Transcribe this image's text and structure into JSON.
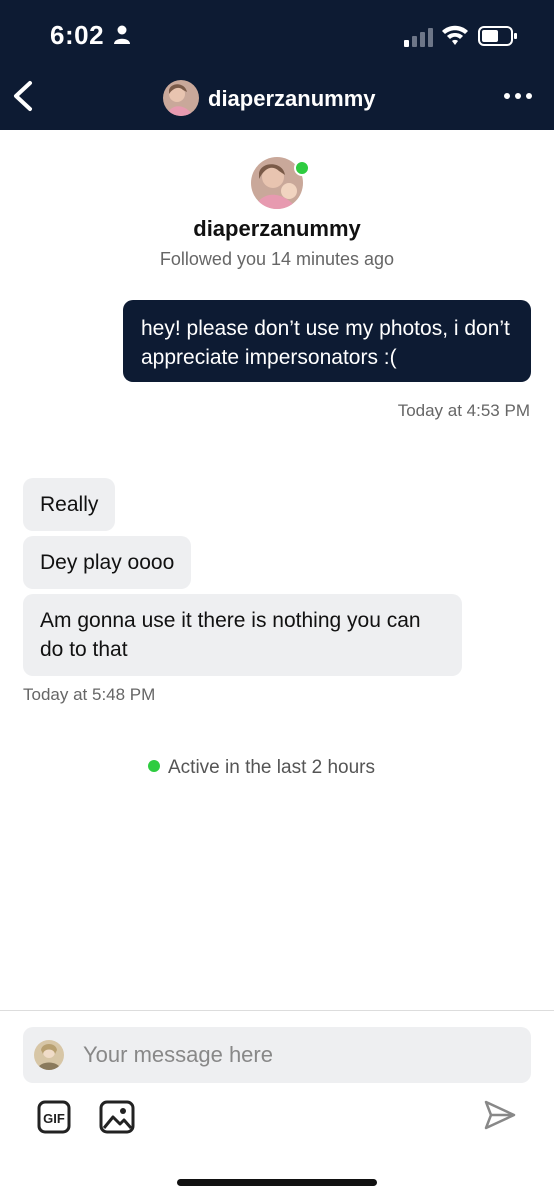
{
  "status_bar": {
    "time": "6:02"
  },
  "nav": {
    "title": "diaperzanummy"
  },
  "profile": {
    "name": "diaperzanummy",
    "subtitle": "Followed you 14 minutes ago"
  },
  "messages": {
    "outgoing": [
      {
        "text": "hey! please don’t use my photos, i don’t appreciate impersonators :("
      }
    ],
    "outgoing_timestamp": "Today at 4:53 PM",
    "incoming": [
      {
        "text": "Really"
      },
      {
        "text": "Dey play oooo"
      },
      {
        "text": "Am gonna use it there is nothing you can do to that"
      }
    ],
    "incoming_timestamp": "Today at 5:48 PM"
  },
  "activity": {
    "status": "Active in the last 2 hours"
  },
  "composer": {
    "placeholder": "Your message here"
  },
  "colors": {
    "header_bg": "#0d1b33",
    "outgoing_bubble": "#0d1b33",
    "incoming_bubble": "#eeeff1",
    "online_green": "#2ecc40"
  },
  "icons": {
    "status": [
      "person-icon",
      "signal-icon",
      "wifi-icon",
      "battery-icon"
    ],
    "nav": [
      "back-icon",
      "more-icon"
    ],
    "composer": [
      "gif-icon",
      "image-icon",
      "send-icon"
    ]
  }
}
